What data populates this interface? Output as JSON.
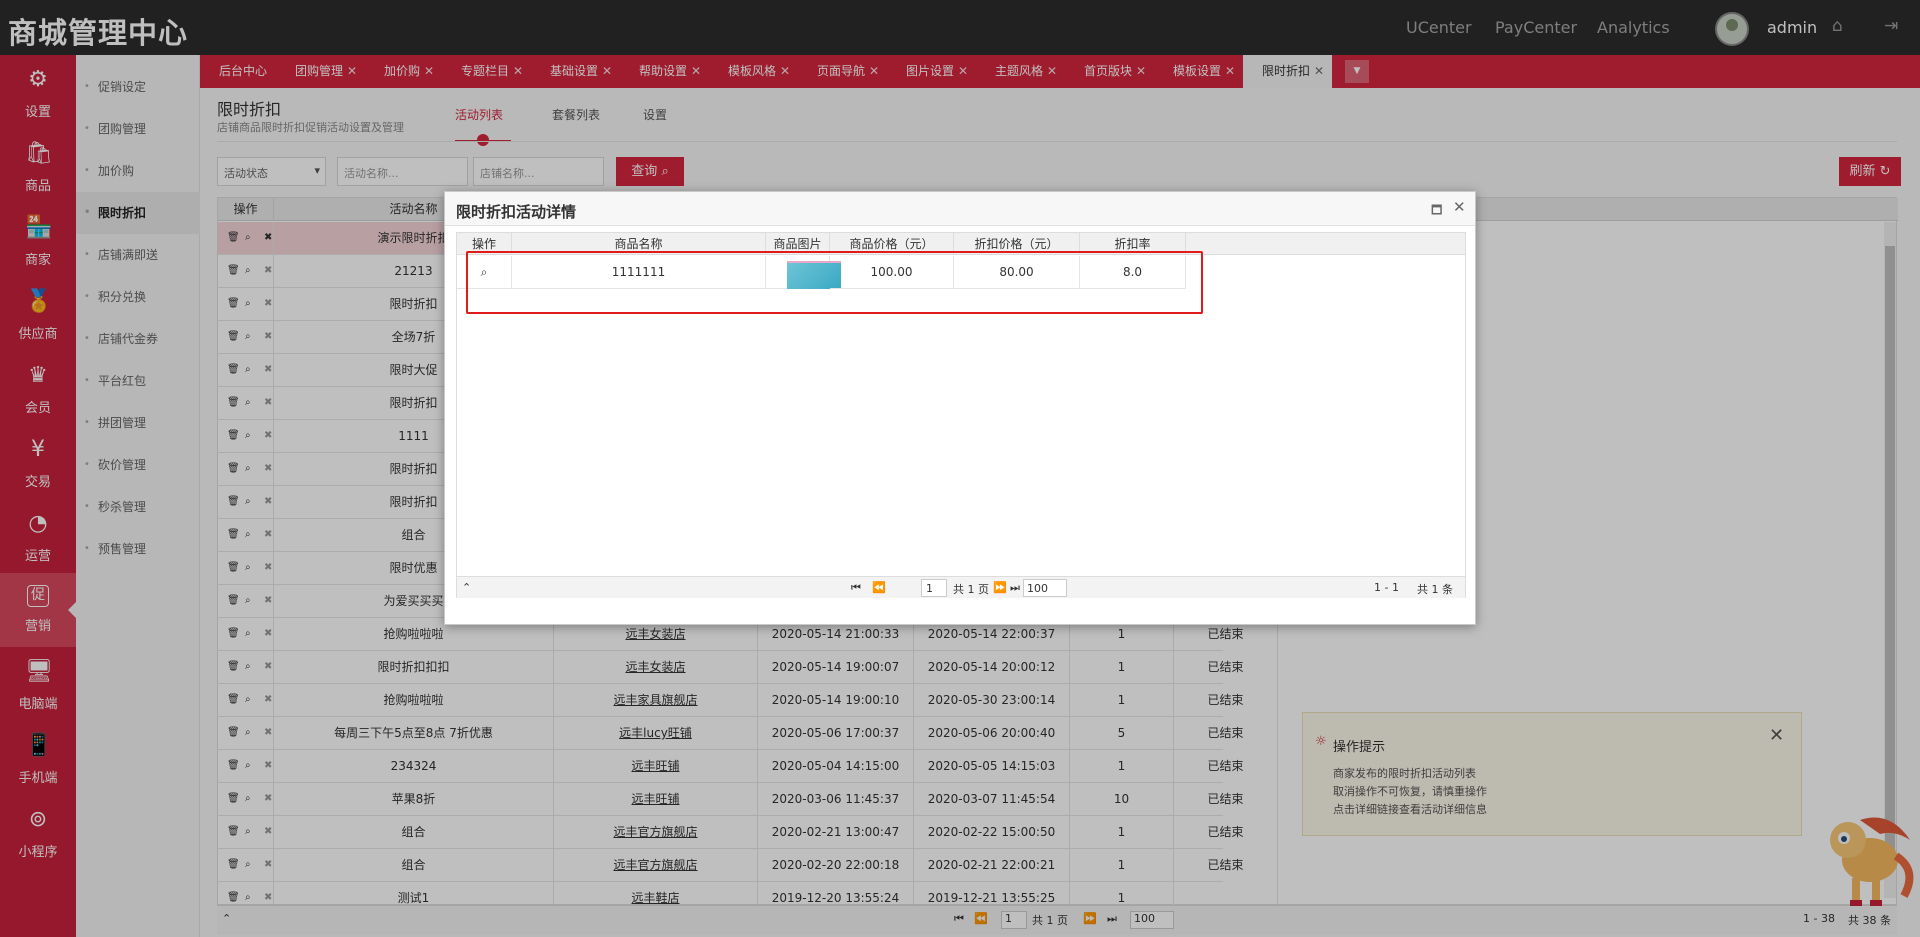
{
  "app": {
    "brand": "商城管理中心",
    "links": [
      "UCenter",
      "PayCenter",
      "Analytics"
    ],
    "username": "admin"
  },
  "nav": [
    {
      "label": "设置",
      "icon": "⚙"
    },
    {
      "label": "商品",
      "icon": "🛍"
    },
    {
      "label": "商家",
      "icon": "🏪"
    },
    {
      "label": "供应商",
      "icon": "🏅"
    },
    {
      "label": "会员",
      "icon": "♛"
    },
    {
      "label": "交易",
      "icon": "¥"
    },
    {
      "label": "运营",
      "icon": "◔"
    },
    {
      "label": "营销",
      "icon": "促"
    },
    {
      "label": "电脑端",
      "icon": "🖥"
    },
    {
      "label": "手机端",
      "icon": "📱"
    },
    {
      "label": "小程序",
      "icon": "⊚"
    }
  ],
  "submenu": [
    "促销设定",
    "团购管理",
    "加价购",
    "限时折扣",
    "店铺满即送",
    "积分兑换",
    "店铺代金券",
    "平台红包",
    "拼团管理",
    "砍价管理",
    "秒杀管理",
    "预售管理"
  ],
  "tabs": [
    "后台中心",
    "团购管理",
    "加价购",
    "专题栏目",
    "基础设置",
    "帮助设置",
    "模板风格",
    "页面导航",
    "图片设置",
    "主题风格",
    "首页版块",
    "模板设置",
    "限时折扣"
  ],
  "page": {
    "title": "限时折扣",
    "desc": "店铺商品限时折扣促销活动设置及管理",
    "tabs": [
      "活动列表",
      "套餐列表",
      "设置"
    ]
  },
  "filters": {
    "status": "活动状态",
    "name_placeholder": "活动名称...",
    "shop_placeholder": "店铺名称...",
    "query": "查询",
    "refresh": "刷新"
  },
  "grid": {
    "headers": [
      "操作",
      "活动名称"
    ],
    "rows": [
      {
        "name": "演示限时折扣",
        "shop": "",
        "start": "",
        "end": "",
        "count": "",
        "status": ""
      },
      {
        "name": "21213",
        "shop": "",
        "start": "",
        "end": "",
        "count": "",
        "status": ""
      },
      {
        "name": "限时折扣",
        "shop": "",
        "start": "",
        "end": "",
        "count": "",
        "status": ""
      },
      {
        "name": "全场7折",
        "shop": "",
        "start": "",
        "end": "",
        "count": "",
        "status": ""
      },
      {
        "name": "限时大促",
        "shop": "",
        "start": "",
        "end": "",
        "count": "",
        "status": ""
      },
      {
        "name": "限时折扣",
        "shop": "",
        "start": "",
        "end": "",
        "count": "",
        "status": ""
      },
      {
        "name": "1111",
        "shop": "",
        "start": "",
        "end": "",
        "count": "",
        "status": ""
      },
      {
        "name": "限时折扣",
        "shop": "",
        "start": "",
        "end": "",
        "count": "",
        "status": ""
      },
      {
        "name": "限时折扣",
        "shop": "",
        "start": "",
        "end": "",
        "count": "",
        "status": ""
      },
      {
        "name": "组合",
        "shop": "",
        "start": "",
        "end": "",
        "count": "",
        "status": ""
      },
      {
        "name": "限时优惠",
        "shop": "",
        "start": "",
        "end": "",
        "count": "",
        "status": ""
      },
      {
        "name": "为爱买买买",
        "shop": "",
        "start": "",
        "end": "",
        "count": "",
        "status": ""
      },
      {
        "name": "抢购啦啦啦",
        "shop": "远丰女装店",
        "start": "2020-05-14 21:00:33",
        "end": "2020-05-14 22:00:37",
        "count": "1",
        "status": "已结束"
      },
      {
        "name": "限时折扣扣扣",
        "shop": "远丰女装店",
        "start": "2020-05-14 19:00:07",
        "end": "2020-05-14 20:00:12",
        "count": "1",
        "status": "已结束"
      },
      {
        "name": "抢购啦啦啦",
        "shop": "远丰家具旗舰店",
        "start": "2020-05-14 19:00:10",
        "end": "2020-05-30 23:00:14",
        "count": "1",
        "status": "已结束"
      },
      {
        "name": "每周三下午5点至8点 7折优惠",
        "shop": "远丰lucy旺铺",
        "start": "2020-05-06 17:00:37",
        "end": "2020-05-06 20:00:40",
        "count": "5",
        "status": "已结束"
      },
      {
        "name": "234324",
        "shop": "远丰旺铺",
        "start": "2020-05-04 14:15:00",
        "end": "2020-05-05 14:15:03",
        "count": "1",
        "status": "已结束"
      },
      {
        "name": "苹果8折",
        "shop": "远丰旺铺",
        "start": "2020-03-06 11:45:37",
        "end": "2020-03-07 11:45:54",
        "count": "10",
        "status": "已结束"
      },
      {
        "name": "组合",
        "shop": "远丰官方旗舰店",
        "start": "2020-02-21 13:00:47",
        "end": "2020-02-22 15:00:50",
        "count": "1",
        "status": "已结束"
      },
      {
        "name": "组合",
        "shop": "远丰官方旗舰店",
        "start": "2020-02-20 22:00:18",
        "end": "2020-02-21 22:00:21",
        "count": "1",
        "status": "已结束"
      },
      {
        "name": "测试1",
        "shop": "远丰鞋店",
        "start": "2019-12-20 13:55:24",
        "end": "2019-12-21 13:55:25",
        "count": "1",
        "status": ""
      }
    ],
    "pager": {
      "page": "1",
      "total_pages": "共 1 页",
      "per_page": "100",
      "range": "1 - 38",
      "total": "共 38 条"
    }
  },
  "tip": {
    "title": "操作提示",
    "lines": [
      "商家发布的限时折扣活动列表",
      "取消操作不可恢复，请慎重操作",
      "点击详细链接查看活动详细信息"
    ]
  },
  "dialog": {
    "title": "限时折扣活动详情",
    "headers": [
      "操作",
      "商品名称",
      "商品图片",
      "商品价格（元）",
      "折扣价格（元）",
      "折扣率"
    ],
    "row": {
      "name": "1111111",
      "price": "100.00",
      "discount_price": "80.00",
      "rate": "8.0"
    },
    "pager": {
      "page": "1",
      "total_pages": "共 1 页",
      "per_page": "100",
      "range": "1 - 1",
      "total": "共 1 条"
    }
  },
  "colors": {
    "accent": "#d4263f",
    "topbar": "#2d2d2d",
    "highlight": "#e11a1a"
  }
}
